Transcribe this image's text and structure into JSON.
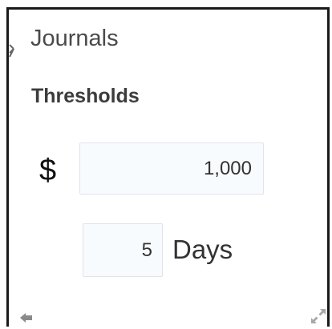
{
  "panel": {
    "title": "Journals",
    "section_title": "Thresholds",
    "currency_symbol": "$",
    "amount_value": "1,000",
    "days_value": "5",
    "days_label": "Days"
  },
  "icons": {
    "resize_handle": "drag-handle-icon",
    "back": "arrow-left-icon",
    "expand": "expand-icon"
  }
}
